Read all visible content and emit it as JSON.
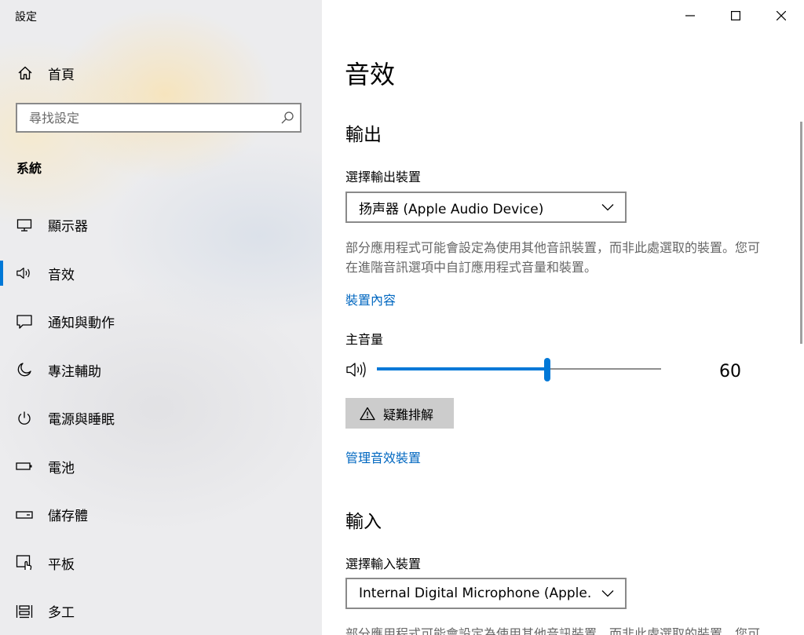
{
  "window": {
    "title": "設定"
  },
  "sidebar": {
    "home_label": "首頁",
    "search_placeholder": "尋找設定",
    "section_title": "系統",
    "items": [
      {
        "label": "顯示器",
        "icon": "display-icon"
      },
      {
        "label": "音效",
        "icon": "speaker-icon",
        "active": true
      },
      {
        "label": "通知與動作",
        "icon": "notification-icon"
      },
      {
        "label": "專注輔助",
        "icon": "moon-icon"
      },
      {
        "label": "電源與睡眠",
        "icon": "power-icon"
      },
      {
        "label": "電池",
        "icon": "battery-icon"
      },
      {
        "label": "儲存體",
        "icon": "storage-icon"
      },
      {
        "label": "平板",
        "icon": "tablet-icon"
      },
      {
        "label": "多工",
        "icon": "multitasking-icon"
      }
    ]
  },
  "main": {
    "title": "音效",
    "output": {
      "heading": "輸出",
      "select_label": "選擇輸出裝置",
      "device": "扬声器 (Apple Audio Device)",
      "description": "部分應用程式可能會設定為使用其他音訊裝置，而非此處選取的裝置。您可在進階音訊選項中自訂應用程式音量和裝置。",
      "properties_link": "裝置內容",
      "volume_label": "主音量",
      "volume": 60,
      "troubleshoot_label": "疑難排解",
      "manage_link": "管理音效裝置"
    },
    "input": {
      "heading": "輸入",
      "select_label": "選擇輸入裝置",
      "device": "Internal Digital Microphone (Apple...",
      "description": "部分應用程式可能會設定為使用其他音訊裝置，而非此處選取的裝置。您可在進階音訊選項中自訂應用程式音量和裝置。"
    }
  },
  "colors": {
    "accent": "#0078d7",
    "link": "#0067c0",
    "sidebar_bg": "#ececee"
  }
}
